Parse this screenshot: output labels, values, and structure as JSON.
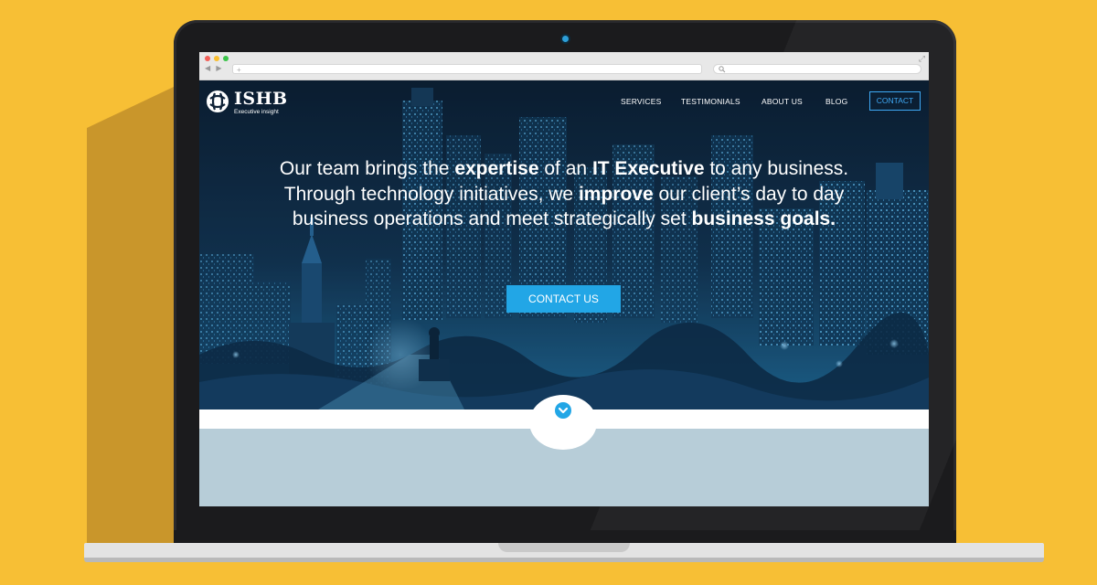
{
  "browser": {
    "back_forward": "◀ ▶",
    "new_tab": "+",
    "search_icon": "search-icon"
  },
  "site": {
    "brand": "ISHB",
    "tagline": "Executive insight",
    "nav": [
      "SERVICES",
      "TESTIMONIALS",
      "ABOUT US",
      "BLOG"
    ],
    "nav_contact": "CONTACT",
    "headline": {
      "t1": "Our team brings the ",
      "b1": "expertise",
      "t2": " of an ",
      "b2": "IT Executive",
      "t3": " to any business. Through technology initiatives, we ",
      "b3": "improve",
      "t4": " our client’s day to day business operations and meet strategically set ",
      "b4": "business goals."
    },
    "cta": "CONTACT US",
    "scroll_icon": "chevron-down-icon"
  },
  "colors": {
    "background": "#f7bf35",
    "accent": "#22a6e6",
    "hero_tint": "#0f2237",
    "lower_section": "#b7cdd8"
  }
}
